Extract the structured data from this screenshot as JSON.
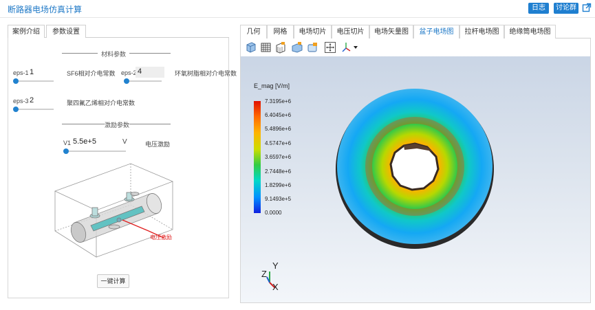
{
  "app": {
    "title": "断路器电场仿真计算"
  },
  "header": {
    "log_label": "日志",
    "discuss_label": "讨论群"
  },
  "left_tabs": [
    {
      "label": "案例介绍"
    },
    {
      "label": "参数设置"
    }
  ],
  "material": {
    "section_title": "材料参数",
    "eps1": {
      "label": "eps-1",
      "value": "1",
      "desc": "SF6相对介电常数"
    },
    "eps2": {
      "label": "eps-2",
      "value": "4",
      "desc": "环氧树脂相对介电常数"
    },
    "eps3": {
      "label": "eps-3",
      "value": "2",
      "desc": "聚四氟乙烯相对介电常数"
    }
  },
  "excitation": {
    "section_title": "激励参数",
    "v1": {
      "label": "V1",
      "value": "5.5e+5",
      "unit": "V",
      "desc": "电压激励"
    }
  },
  "model": {
    "callout": "电压激励"
  },
  "calc_button": "一键计算",
  "right_tabs": [
    {
      "label": "几何"
    },
    {
      "label": "网格"
    },
    {
      "label": "电场切片"
    },
    {
      "label": "电压切片"
    },
    {
      "label": "电场矢量图"
    },
    {
      "label": "盆子电场图"
    },
    {
      "label": "拉杆电场图"
    },
    {
      "label": "绝缘筒电场图"
    }
  ],
  "toolbar": {
    "icons": [
      "view-cube-icon",
      "mesh-grid-icon",
      "wireframe-icon",
      "surface-icon",
      "edges-icon",
      "fit-view-icon",
      "axes-orient-icon"
    ]
  },
  "legend": {
    "title": "E_mag [V/m]",
    "ticks": [
      "7.3195e+6",
      "6.4045e+6",
      "5.4896e+6",
      "4.5747e+6",
      "3.6597e+6",
      "2.7448e+6",
      "1.8299e+6",
      "9.1493e+5",
      "0.0000"
    ]
  },
  "axes": {
    "x": "X",
    "y": "Y",
    "z": "Z"
  }
}
